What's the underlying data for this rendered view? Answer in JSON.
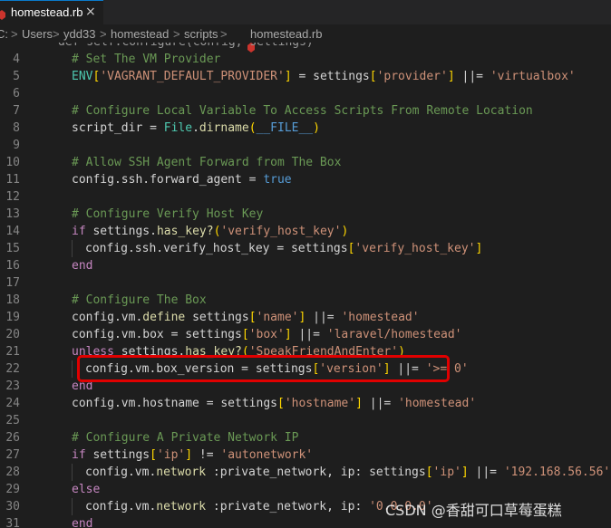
{
  "tab": {
    "label": "homestead.rb",
    "close_glyph": "×"
  },
  "breadcrumb": {
    "parts": [
      "C:",
      "Users",
      "ydd33",
      "homestead",
      "scripts"
    ],
    "file": "homestead.rb",
    "separator": ">"
  },
  "lines": [
    {
      "n": "",
      "top_partial": "def self.configure(config, settings)"
    },
    {
      "n": "4",
      "segs": [
        [
          "c",
          "# Set The VM Provider"
        ]
      ]
    },
    {
      "n": "5",
      "segs": [
        [
          "t",
          "ENV"
        ],
        [
          "y",
          "["
        ],
        [
          "s",
          "'VAGRANT_DEFAULT_PROVIDER'"
        ],
        [
          "y",
          "]"
        ],
        [
          "o",
          " = settings"
        ],
        [
          "y",
          "["
        ],
        [
          "s",
          "'provider'"
        ],
        [
          "y",
          "]"
        ],
        [
          "o",
          " ||= "
        ],
        [
          "s",
          "'virtualbox'"
        ]
      ]
    },
    {
      "n": "6",
      "segs": []
    },
    {
      "n": "7",
      "segs": [
        [
          "c",
          "# Configure Local Variable To Access Scripts From Remote Location"
        ]
      ]
    },
    {
      "n": "8",
      "segs": [
        [
          "o",
          "script_dir = "
        ],
        [
          "t",
          "File"
        ],
        [
          "o",
          "."
        ],
        [
          "f",
          "dirname"
        ],
        [
          "y",
          "("
        ],
        [
          "k",
          "__FILE__"
        ],
        [
          "y",
          ")"
        ]
      ]
    },
    {
      "n": "9",
      "segs": []
    },
    {
      "n": "10",
      "segs": [
        [
          "c",
          "# Allow SSH Agent Forward from The Box"
        ]
      ]
    },
    {
      "n": "11",
      "segs": [
        [
          "o",
          "config.ssh.forward_agent = "
        ],
        [
          "k",
          "true"
        ]
      ]
    },
    {
      "n": "12",
      "segs": []
    },
    {
      "n": "13",
      "segs": [
        [
          "c",
          "# Configure Verify Host Key"
        ]
      ]
    },
    {
      "n": "14",
      "segs": [
        [
          "p",
          "if"
        ],
        [
          "o",
          " settings."
        ],
        [
          "f",
          "has_key?"
        ],
        [
          "y",
          "("
        ],
        [
          "s",
          "'verify_host_key'"
        ],
        [
          "y",
          ")"
        ]
      ]
    },
    {
      "n": "15",
      "indent": true,
      "segs": [
        [
          "o",
          "config.ssh.verify_host_key = settings"
        ],
        [
          "y",
          "["
        ],
        [
          "s",
          "'verify_host_key'"
        ],
        [
          "y",
          "]"
        ]
      ]
    },
    {
      "n": "16",
      "segs": [
        [
          "p",
          "end"
        ]
      ]
    },
    {
      "n": "17",
      "segs": []
    },
    {
      "n": "18",
      "segs": [
        [
          "c",
          "# Configure The Box"
        ]
      ]
    },
    {
      "n": "19",
      "segs": [
        [
          "o",
          "config.vm."
        ],
        [
          "f",
          "define"
        ],
        [
          "o",
          " settings"
        ],
        [
          "y",
          "["
        ],
        [
          "s",
          "'name'"
        ],
        [
          "y",
          "]"
        ],
        [
          "o",
          " ||= "
        ],
        [
          "s",
          "'homestead'"
        ]
      ]
    },
    {
      "n": "20",
      "segs": [
        [
          "o",
          "config.vm.box = settings"
        ],
        [
          "y",
          "["
        ],
        [
          "s",
          "'box'"
        ],
        [
          "y",
          "]"
        ],
        [
          "o",
          " ||= "
        ],
        [
          "s",
          "'laravel/homestead'"
        ]
      ]
    },
    {
      "n": "21",
      "segs": [
        [
          "p",
          "unless"
        ],
        [
          "o",
          " settings."
        ],
        [
          "f",
          "has_key?"
        ],
        [
          "y",
          "("
        ],
        [
          "s",
          "'SpeakFriendAndEnter'"
        ],
        [
          "y",
          ")"
        ]
      ]
    },
    {
      "n": "22",
      "indent": true,
      "segs": [
        [
          "o",
          "config.vm.box_version = settings"
        ],
        [
          "y",
          "["
        ],
        [
          "s",
          "'version'"
        ],
        [
          "y",
          "]"
        ],
        [
          "o",
          " ||= "
        ],
        [
          "s",
          "'>= 0'"
        ]
      ]
    },
    {
      "n": "23",
      "segs": [
        [
          "p",
          "end"
        ]
      ]
    },
    {
      "n": "24",
      "segs": [
        [
          "o",
          "config.vm.hostname = settings"
        ],
        [
          "y",
          "["
        ],
        [
          "s",
          "'hostname'"
        ],
        [
          "y",
          "]"
        ],
        [
          "o",
          " ||= "
        ],
        [
          "s",
          "'homestead'"
        ]
      ]
    },
    {
      "n": "25",
      "segs": []
    },
    {
      "n": "26",
      "segs": [
        [
          "c",
          "# Configure A Private Network IP"
        ]
      ]
    },
    {
      "n": "27",
      "segs": [
        [
          "p",
          "if"
        ],
        [
          "o",
          " settings"
        ],
        [
          "y",
          "["
        ],
        [
          "s",
          "'ip'"
        ],
        [
          "y",
          "]"
        ],
        [
          "o",
          " != "
        ],
        [
          "s",
          "'autonetwork'"
        ]
      ]
    },
    {
      "n": "28",
      "indent": true,
      "segs": [
        [
          "o",
          "config.vm."
        ],
        [
          "f",
          "network"
        ],
        [
          "o",
          " :private_network, ip: settings"
        ],
        [
          "y",
          "["
        ],
        [
          "s",
          "'ip'"
        ],
        [
          "y",
          "]"
        ],
        [
          "o",
          " ||= "
        ],
        [
          "s",
          "'192.168.56.56'"
        ]
      ]
    },
    {
      "n": "29",
      "segs": [
        [
          "p",
          "else"
        ]
      ]
    },
    {
      "n": "30",
      "indent": true,
      "segs": [
        [
          "o",
          "config.vm."
        ],
        [
          "f",
          "network"
        ],
        [
          "o",
          " :private_network, ip: "
        ],
        [
          "s",
          "'0.0.0.0'"
        ]
      ]
    },
    {
      "n": "31",
      "segs": [
        [
          "p",
          "end"
        ]
      ]
    }
  ],
  "watermark": "CSDN @香甜可口草莓蛋糕",
  "colors": {
    "background": "#1e1e1e",
    "comment": "#6a9955",
    "string": "#ce9178",
    "keyword": "#569cd6",
    "highlight_box": "#e00000"
  },
  "icons": {
    "file_icon": "ruby-icon"
  }
}
